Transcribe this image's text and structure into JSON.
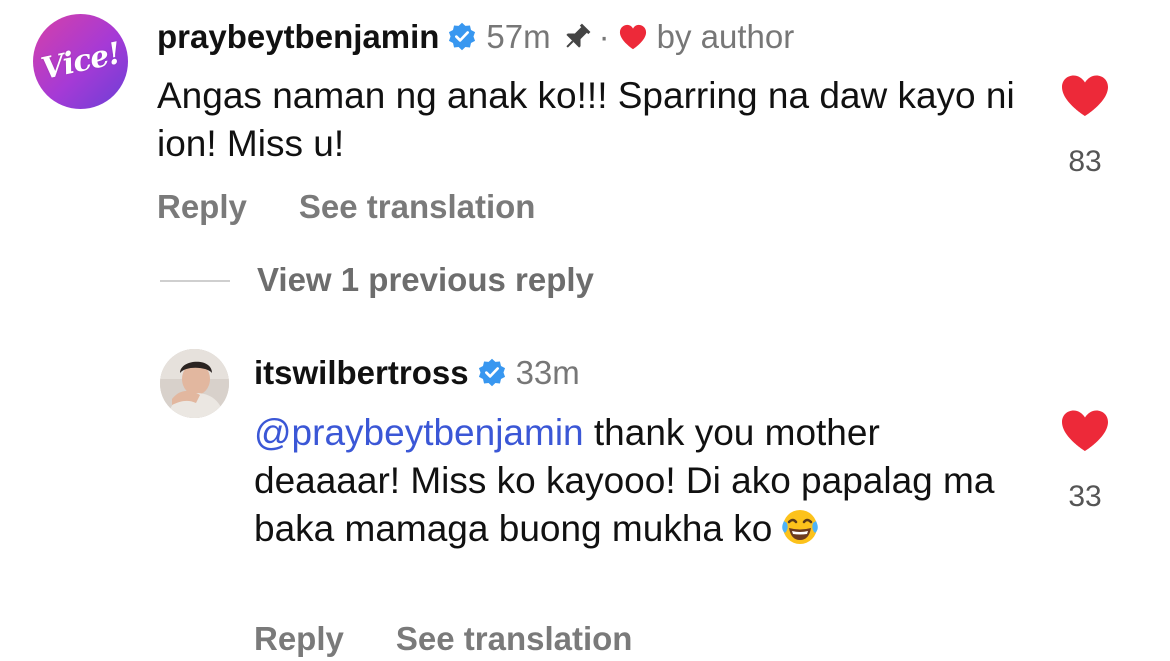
{
  "comments": [
    {
      "username": "praybeytbenjamin",
      "time": "57m",
      "separator": "·",
      "by_author": "by author",
      "avatar_text": "Vice!",
      "text": "Angas naman ng anak ko!!! Sparring na daw kayo ni ion! Miss u!",
      "like_count": "83",
      "reply_label": "Reply",
      "translate_label": "See translation"
    },
    {
      "username": "itswilbertross",
      "time": "33m",
      "mention": "@praybeytbenjamin",
      "text": " thank you mother deaaaar! Miss ko kayooo! Di ako papalag ma baka mamaga buong mukha ko",
      "like_count": "33",
      "reply_label": "Reply",
      "translate_label": "See translation"
    }
  ],
  "thread": {
    "view_previous": "View 1 previous reply"
  },
  "icons": {
    "verified": "verified-badge-icon",
    "pin": "pin-icon",
    "author_heart": "heart-icon",
    "like": "heart-like-icon",
    "emoji": "laughing-tears-emoji-icon"
  },
  "colors": {
    "heart": "#ed2939",
    "verified": "#3897f0",
    "mention": "#3b57d6",
    "secondary_text": "#777777"
  }
}
